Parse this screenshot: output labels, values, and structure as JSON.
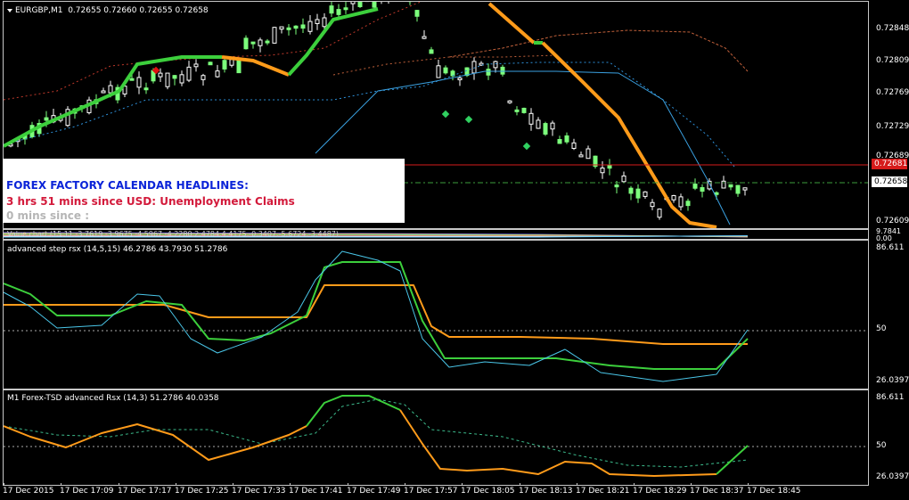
{
  "main_chart": {
    "symbol_label": "EURGBP,M1",
    "ohlc": "0.72655 0.72660 0.72655 0.72658",
    "indicator_overlap_label": "Value chart (15,11,-3.7619,-3.9675,-4.5967,-4.2280,2.4784,4.4175,-0.3407,-5.6724,-3.4487)",
    "price_ticks": [
      "0.72848",
      "0.72809",
      "0.72769",
      "0.72729",
      "0.72689",
      "0.72658",
      "0.72609"
    ],
    "current_price_tag": "0.72681",
    "last_price_tag": "0.72658",
    "extra_ticks": [
      "9.7841",
      "0.00"
    ],
    "colors": {
      "bull_candle": "#7cff7c",
      "bear_candle": "#ffffff",
      "trend_green": "#3ccf3c",
      "trend_orange": "#ff9b1a",
      "band_blue": "#2d8fd8",
      "band_red": "#c0392b",
      "price_line": "#d61b1b"
    }
  },
  "news": {
    "title": "FOREX FACTORY CALENDAR  HEADLINES:",
    "line1": "3 hrs 51 mins since USD: Unemployment Claims",
    "line2": "0 mins since :"
  },
  "rsx_pane": {
    "label": "advanced step rsx (14,5,15) 46.2786 43.7930 51.2786",
    "ticks": [
      "86.611",
      "50",
      "26.0397"
    ]
  },
  "tsd_pane": {
    "label": "M1 Forex-TSD advanced Rsx (14,3) 51.2786 40.0358",
    "ticks": [
      "86.611",
      "50",
      "26.0397"
    ]
  },
  "time_axis": [
    "17 Dec 2015",
    "17 Dec 17:09",
    "17 Dec 17:17",
    "17 Dec 17:25",
    "17 Dec 17:33",
    "17 Dec 17:41",
    "17 Dec 17:49",
    "17 Dec 17:57",
    "17 Dec 18:05",
    "17 Dec 18:13",
    "17 Dec 18:21",
    "17 Dec 18:29",
    "17 Dec 18:37",
    "17 Dec 18:45"
  ]
}
